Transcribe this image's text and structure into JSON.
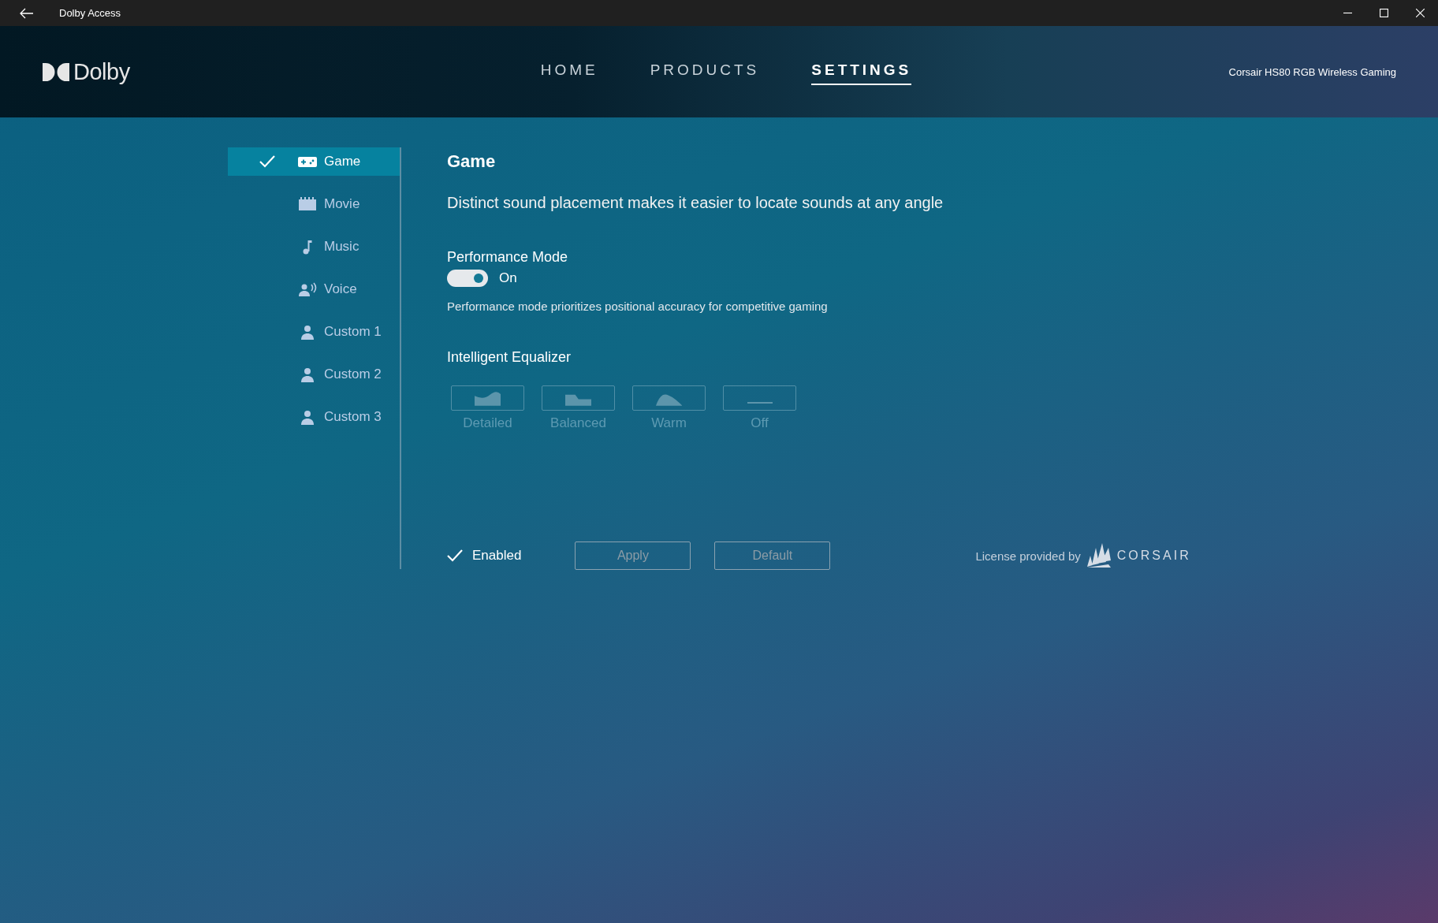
{
  "window": {
    "title": "Dolby Access"
  },
  "header": {
    "logo": "Dolby",
    "nav": [
      {
        "label": "HOME",
        "selected": false
      },
      {
        "label": "PRODUCTS",
        "selected": false
      },
      {
        "label": "SETTINGS",
        "selected": true
      }
    ],
    "device": "Corsair HS80 RGB Wireless Gaming"
  },
  "sidebar": {
    "items": [
      {
        "label": "Game",
        "kind": "game",
        "selected": true
      },
      {
        "label": "Movie",
        "kind": "movie",
        "selected": false
      },
      {
        "label": "Music",
        "kind": "music",
        "selected": false
      },
      {
        "label": "Voice",
        "kind": "voice",
        "selected": false
      },
      {
        "label": "Custom 1",
        "kind": "custom",
        "selected": false
      },
      {
        "label": "Custom 2",
        "kind": "custom",
        "selected": false
      },
      {
        "label": "Custom 3",
        "kind": "custom",
        "selected": false
      }
    ]
  },
  "content": {
    "title": "Game",
    "description": "Distinct sound placement makes it easier to locate sounds at any angle",
    "performance_mode": {
      "label": "Performance Mode",
      "on": true,
      "state_text": "On",
      "note": "Performance mode prioritizes positional accuracy for competitive gaming"
    },
    "equalizer": {
      "label": "Intelligent Equalizer",
      "disabled": true,
      "presets": [
        {
          "label": "Detailed",
          "kind": "detailed",
          "selected": false
        },
        {
          "label": "Balanced",
          "kind": "balanced",
          "selected": false
        },
        {
          "label": "Warm",
          "kind": "warm",
          "selected": false
        },
        {
          "label": "Off",
          "kind": "off",
          "selected": false
        }
      ]
    },
    "enabled": {
      "label": "Enabled",
      "checked": true
    },
    "buttons": [
      {
        "label": "Apply",
        "disabled": true
      },
      {
        "label": "Default",
        "disabled": true
      }
    ],
    "license": {
      "text": "License provided by",
      "brand": "CORSAIR"
    }
  }
}
